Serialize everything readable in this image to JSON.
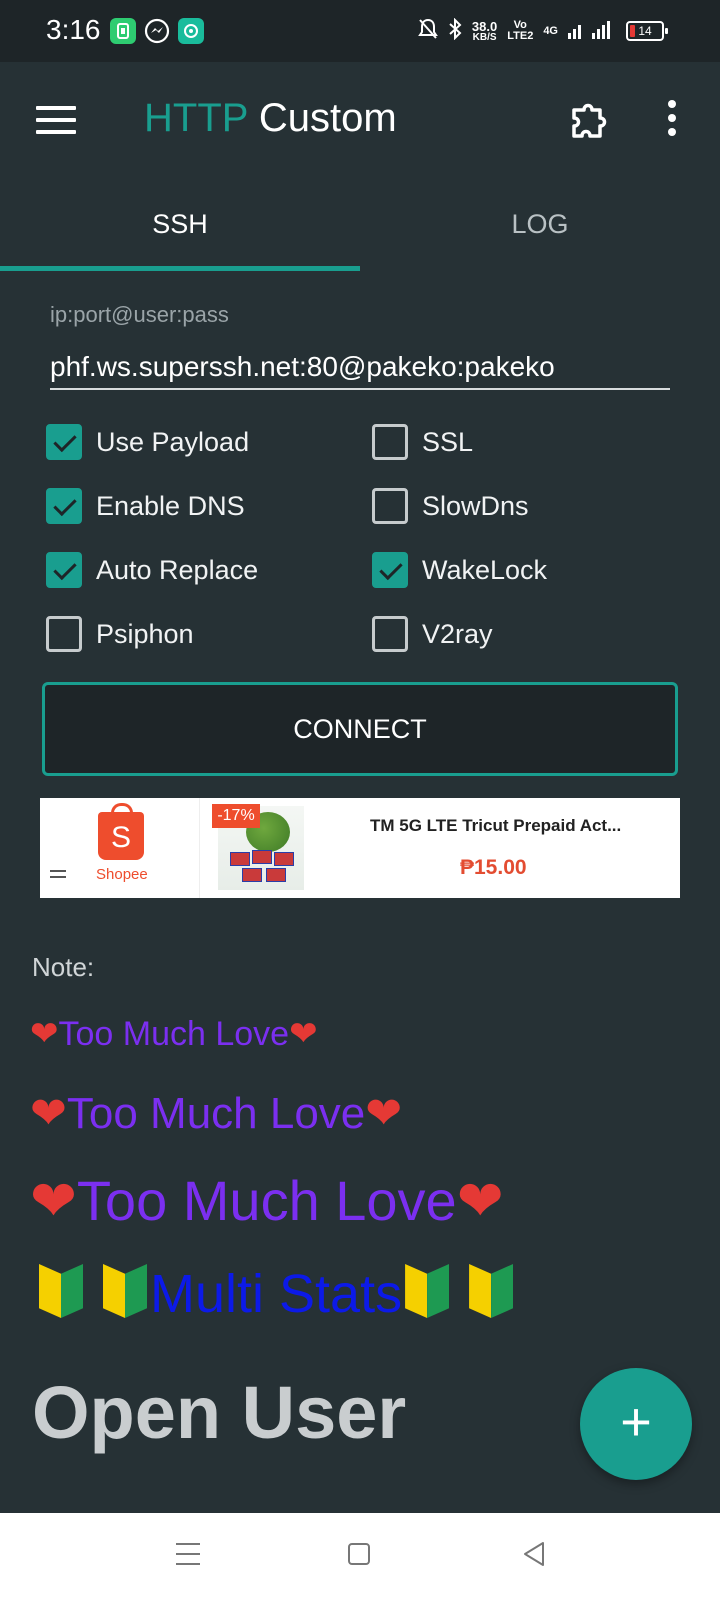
{
  "status_bar": {
    "time": "3:16",
    "speed_value": "38.0",
    "speed_unit": "KB/S",
    "volte_top": "Vo",
    "volte_bottom": "LTE2",
    "network": "4G",
    "battery_level": "14",
    "icons": [
      "app-notification-icon",
      "messenger-icon",
      "app-icon",
      "mute-bell-icon",
      "bluetooth-icon",
      "signal-icon",
      "battery-icon"
    ]
  },
  "app_bar": {
    "title_part1": "HTTP",
    "title_part2": "Custom",
    "accent_color": "#199e8f",
    "icons": [
      "menu-icon",
      "puzzle-icon",
      "more-vert-icon"
    ]
  },
  "tabs": [
    {
      "label": "SSH",
      "active": true
    },
    {
      "label": "LOG",
      "active": false
    }
  ],
  "ssh": {
    "field_label": "ip:port@user:pass",
    "field_value": "phf.ws.superssh.net:80@pakeko:pakeko",
    "options": [
      {
        "label": "Use Payload",
        "checked": true
      },
      {
        "label": "SSL",
        "checked": false
      },
      {
        "label": "Enable DNS",
        "checked": true
      },
      {
        "label": "SlowDns",
        "checked": false
      },
      {
        "label": "Auto Replace",
        "checked": true
      },
      {
        "label": "WakeLock",
        "checked": true
      },
      {
        "label": "Psiphon",
        "checked": false
      },
      {
        "label": "V2ray",
        "checked": false
      }
    ],
    "connect_label": "CONNECT"
  },
  "ad": {
    "brand": "Shopee",
    "brand_letter": "S",
    "discount": "-17%",
    "title": "TM 5G LTE Tricut Prepaid Act...",
    "price": "₱15.00",
    "brand_color": "#ee4d2d"
  },
  "note": {
    "label": "Note:",
    "heart": "❤",
    "love_text": "Too Much Love",
    "multi_text": "Multi Stats",
    "open_user": "Open User"
  },
  "fab": {
    "label": "+"
  },
  "nav": {
    "icons": [
      "recent-apps-icon",
      "home-icon",
      "back-icon"
    ]
  }
}
